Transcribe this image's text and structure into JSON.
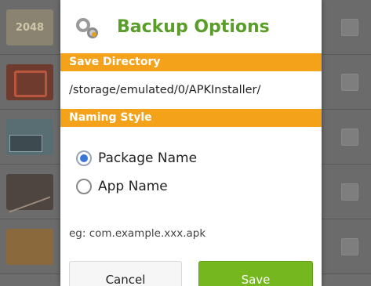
{
  "background_app": {
    "first_tile_text": "2048"
  },
  "dialog": {
    "title": "Backup Options",
    "icon": "wrench-gear-icon",
    "save_directory": {
      "label": "Save Directory",
      "value": "/storage/emulated/0/APKInstaller/"
    },
    "naming_style": {
      "label": "Naming Style",
      "options": [
        {
          "label": "Package Name",
          "selected": true
        },
        {
          "label": "App Name",
          "selected": false
        }
      ]
    },
    "example_text": "eg: com.example.xxx.apk",
    "buttons": {
      "cancel_label": "Cancel",
      "save_label": "Save"
    }
  },
  "colors": {
    "title_green": "#5a9e2a",
    "section_orange": "#f4a21a",
    "save_green": "#74b71f",
    "radio_blue": "#3a76d8"
  }
}
